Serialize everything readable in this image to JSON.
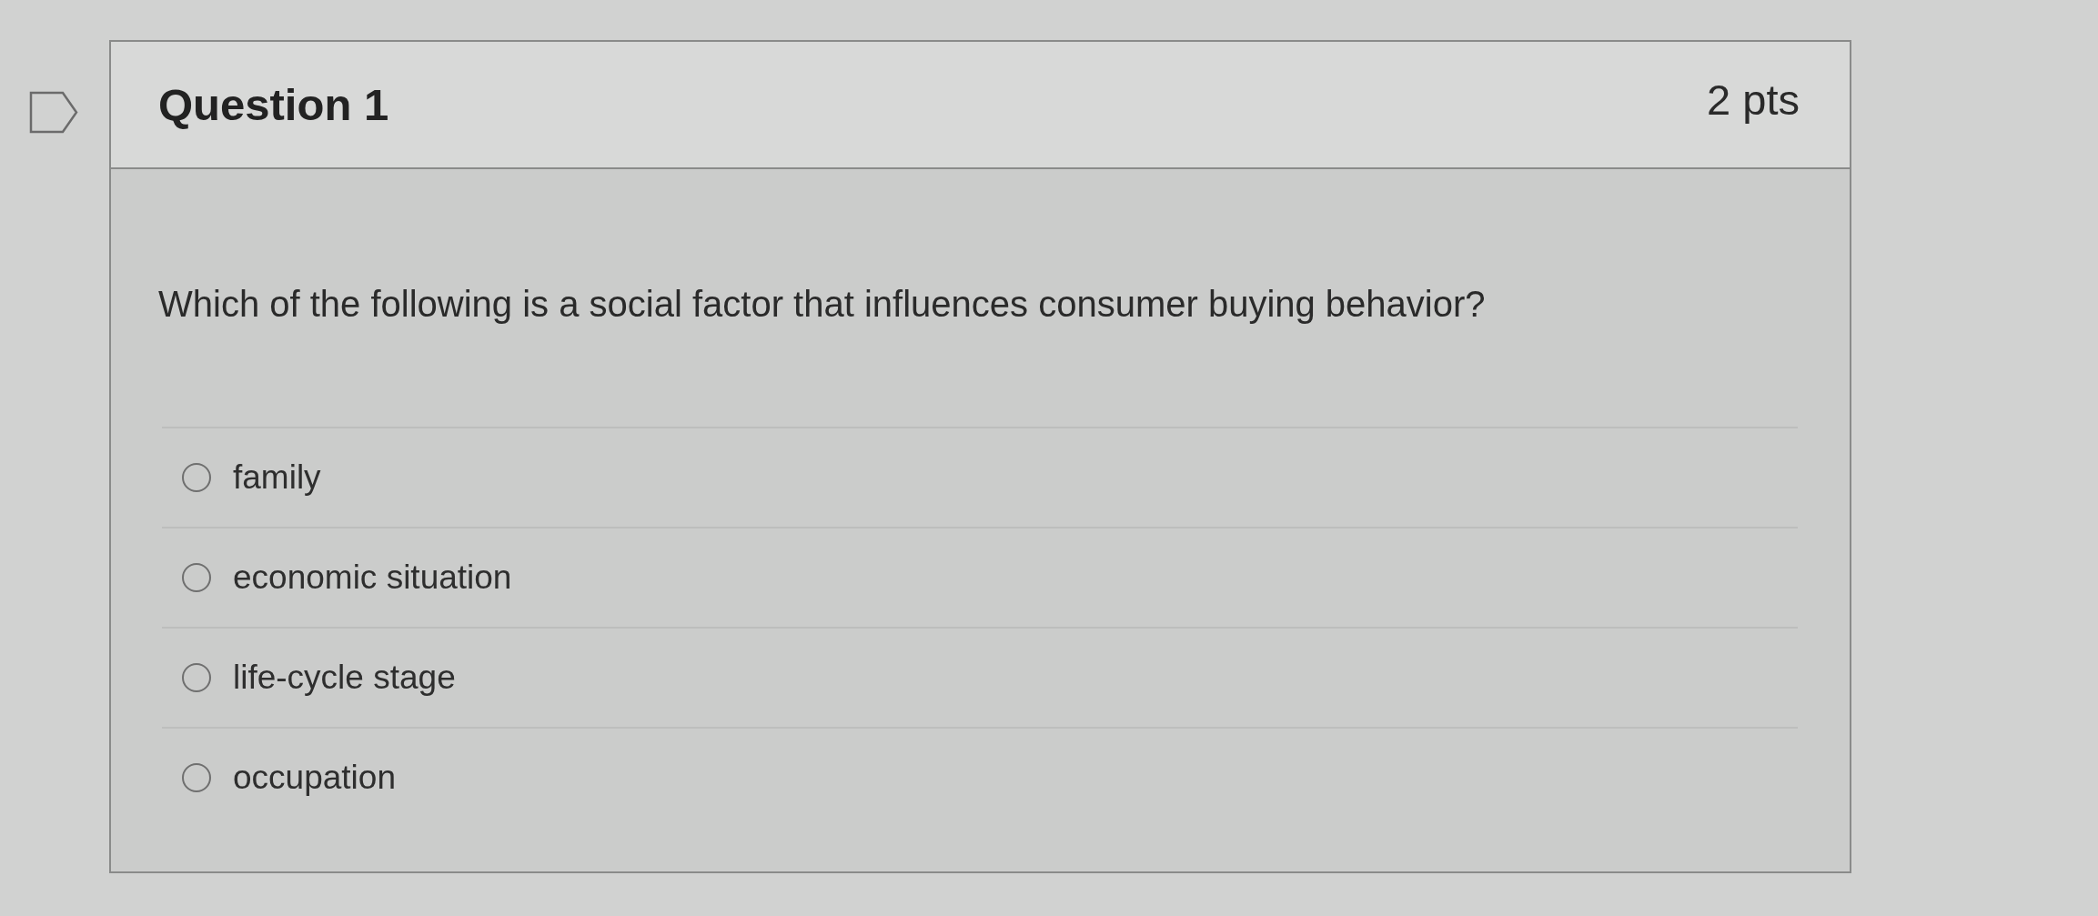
{
  "question": {
    "flagged": false,
    "title": "Question 1",
    "points": "2 pts",
    "text": "Which of the following is a social factor that influences consumer buying behavior?",
    "answers": [
      {
        "label": "family",
        "selected": false
      },
      {
        "label": "economic situation",
        "selected": false
      },
      {
        "label": "life-cycle stage",
        "selected": false
      },
      {
        "label": "occupation",
        "selected": false
      }
    ]
  }
}
